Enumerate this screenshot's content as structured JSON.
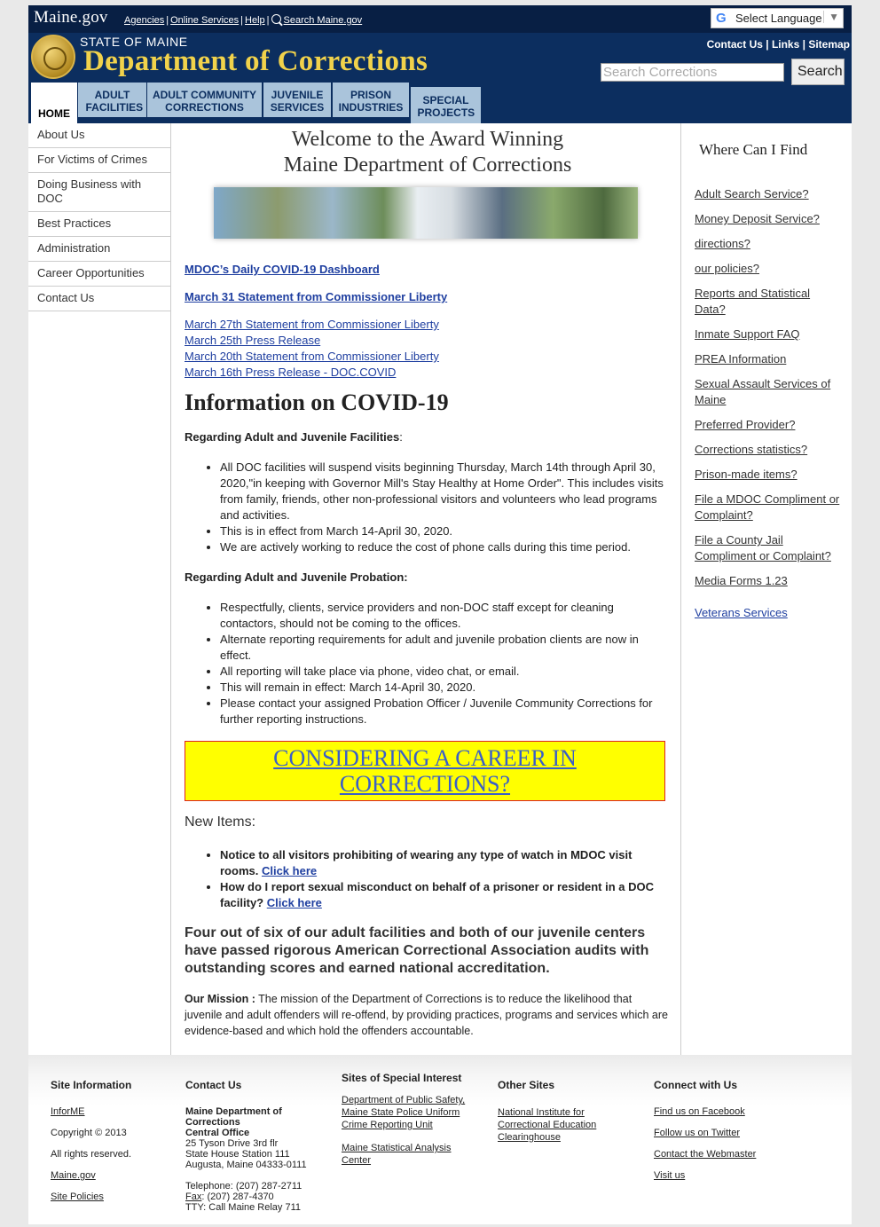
{
  "header": {
    "maine_gov": "Maine.gov",
    "top_links": [
      "Agencies",
      "Online Services",
      "Help",
      "Search Maine.gov"
    ],
    "select_language": "Select Language",
    "state": "STATE OF MAINE",
    "dept": "Department of Corrections",
    "util_links": [
      "Contact Us",
      "Links",
      "Sitemap"
    ],
    "search_placeholder": "Search Corrections",
    "search_button": "Search",
    "tabs": [
      {
        "label": "HOME"
      },
      {
        "label": "ADULT FACILITIES"
      },
      {
        "label": "ADULT COMMUNITY CORRECTIONS"
      },
      {
        "label": "JUVENILE SERVICES"
      },
      {
        "label": "PRISON INDUSTRIES"
      },
      {
        "label": "SPECIAL PROJECTS"
      }
    ]
  },
  "leftnav": [
    "About Us",
    "For Victims of Crimes",
    "Doing Business with DOC",
    "Best Practices",
    "Administration",
    "Career Opportunities",
    "Contact Us"
  ],
  "main": {
    "welcome_1": "Welcome to the Award Winning",
    "welcome_2": "Maine Department of Corrections",
    "bold_links": [
      "MDOC’s Daily COVID-19 Dashboard",
      "March 31 Statement from Commissioner Liberty"
    ],
    "links": [
      "March 27th Statement from Commissioner Liberty",
      "March 25th Press Release",
      "March 20th Statement from Commissioner Liberty",
      "March 16th Press Release - DOC.COVID"
    ],
    "covid_heading": "Information on COVID-19",
    "facilities_heading": "Regarding Adult and Juvenile Facilities",
    "facilities_colon": ":",
    "facilities_bullets": [
      "All DOC facilities will suspend visits beginning Thursday, March 14th through April 30, 2020,\"in keeping with Governor Mill's Stay Healthy at Home Order\". This includes visits from family, friends, other non-professional visitors and volunteers who lead programs and activities.",
      "This is in effect from March 14-April 30, 2020.",
      "We are actively working to reduce the cost of phone calls during this time period."
    ],
    "probation_heading": "Regarding Adult and Juvenile Probation:",
    "probation_bullets": [
      "Respectfully, clients, service providers and non-DOC staff except for cleaning contactors, should not be coming to the offices.",
      "Alternate reporting requirements for adult and juvenile probation clients are now in effect.",
      "All reporting will take place via phone, video chat, or email.",
      "This will remain in effect: March 14-April 30, 2020.",
      "Please contact your assigned Probation Officer / Juvenile Community Corrections for further reporting instructions."
    ],
    "career_1": "CONSIDERING A CAREER IN",
    "career_2": "CORRECTIONS?",
    "new_items": "New Items:",
    "new_item_1": "Notice to all visitors prohibiting of wearing any type of watch in MDOC visit rooms.",
    "new_item_2": "How do I report sexual misconduct on behalf of a prisoner or resident in a DOC facility?",
    "click_here": "Click here",
    "four_out": "Four out of six of our adult facilities and both of our juvenile centers have passed rigorous American Correctional Association audits with outstanding scores and earned national accreditation.",
    "mission_label": "Our Mission :",
    "mission_text": "The mission of the Department of Corrections is to reduce the likelihood that juvenile and adult offenders will re-offend, by providing practices, programs and services which are evidence-based and which hold the offenders accountable."
  },
  "right": {
    "title": "Where Can I Find",
    "links": [
      "Adult Search Service?",
      "Money Deposit Service?",
      "directions?",
      "our policies?",
      "Reports and Statistical Data?",
      "Inmate Support FAQ",
      "PREA Information",
      "Sexual Assault Services of Maine",
      "Preferred Provider?",
      "Corrections statistics?",
      "Prison-made items?",
      "File a MDOC Compliment or Complaint?",
      "File a County Jail Compliment or Complaint?",
      "Media Forms 1.23",
      "Veterans Services"
    ]
  },
  "footer": {
    "site_info": {
      "title": "Site Information",
      "informe": "InforME",
      "copyright": "Copyright © 2013",
      "rights": "All rights reserved.",
      "maine_gov": "Maine.gov",
      "policies": "Site Policies"
    },
    "contact": {
      "title": "Contact Us",
      "org": "Maine Department of Corrections",
      "office": "Central Office",
      "addr1": "25 Tyson Drive 3rd flr",
      "addr2": "State House Station 111",
      "addr3": "Augusta, Maine 04333-0111",
      "phone": "Telephone: (207) 287-2711",
      "fax_label": "Fax",
      "fax": ": (207) 287-4370",
      "tty": "TTY: Call Maine Relay 711"
    },
    "special": {
      "title": "Sites of Special Interest",
      "link1": "Department of Public Safety, Maine State Police Uniform Crime Reporting Unit",
      "link2": "Maine Statistical Analysis Center"
    },
    "other": {
      "title": "Other Sites",
      "link1": "National Institute for Correctional Education Clearinghouse"
    },
    "connect": {
      "title": "Connect with Us",
      "links": [
        "Find us on Facebook",
        "Follow us on Twitter",
        "Contact the Webmaster",
        "Visit us"
      ]
    }
  }
}
